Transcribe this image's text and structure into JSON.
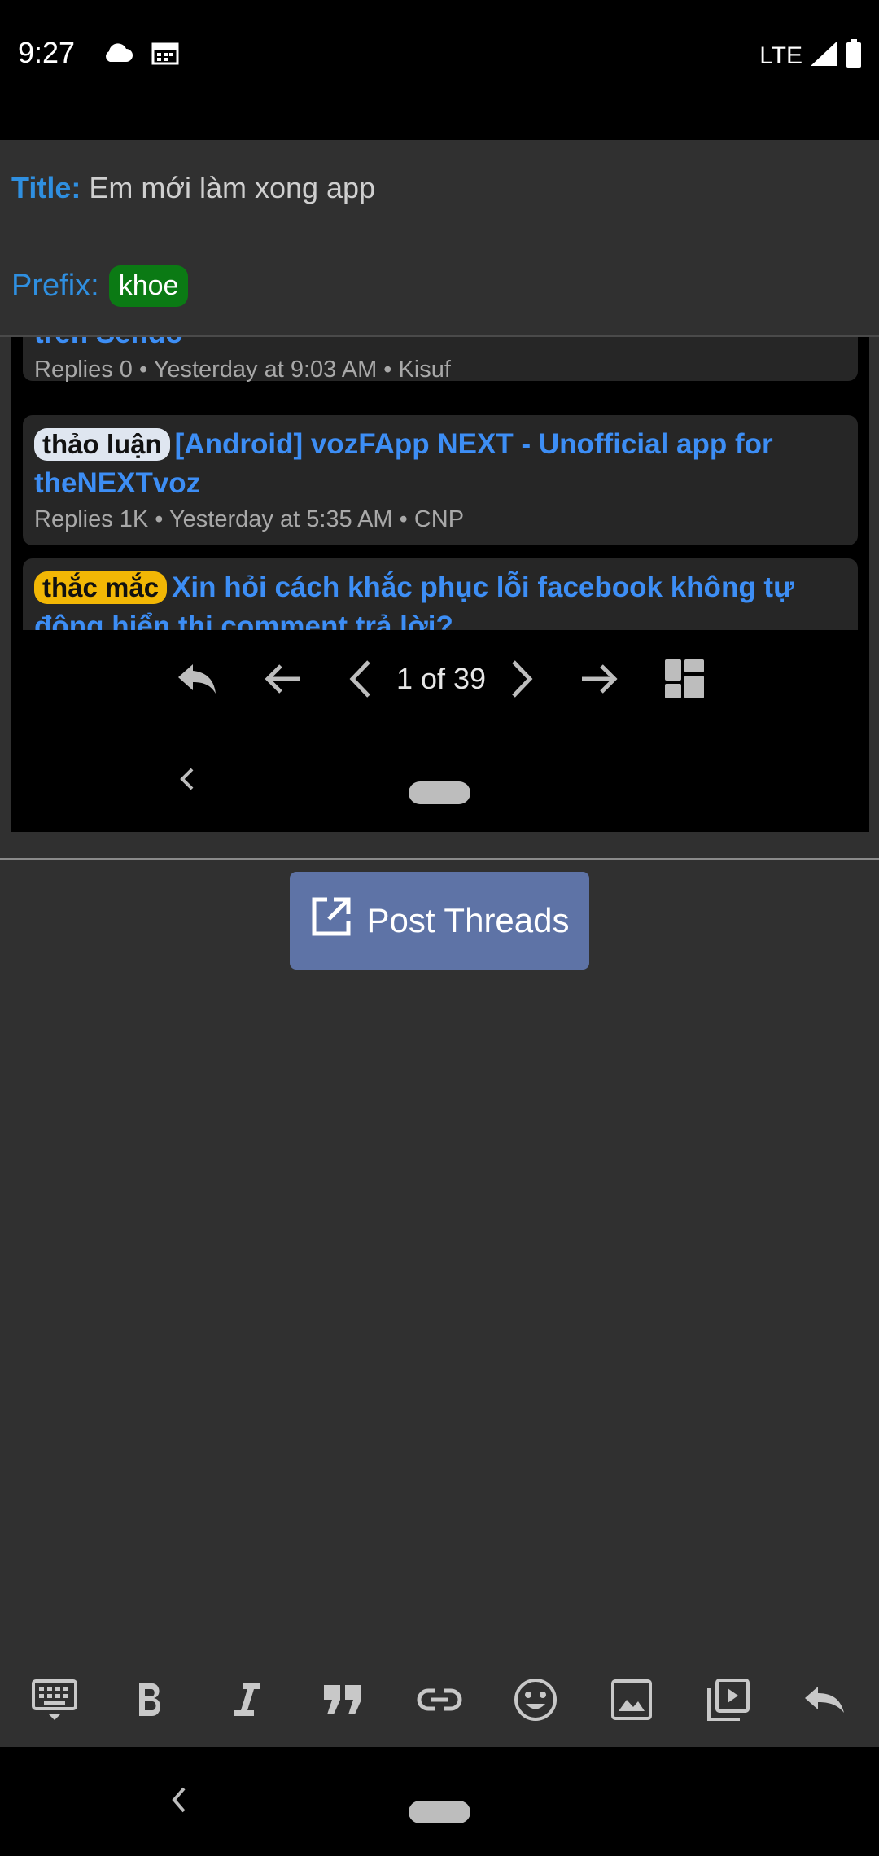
{
  "status_bar": {
    "time": "9:27",
    "network": "LTE",
    "icons": [
      "cloud-icon",
      "calendar-icon",
      "signal-icon",
      "battery-icon"
    ]
  },
  "header": {
    "title_label": "Title:",
    "title_value": "Em mới làm xong app",
    "prefix_label": "Prefix:",
    "prefix_value": "khoe",
    "prefix_color": "#0b7a14"
  },
  "preview": {
    "threads": [
      {
        "tag": "",
        "title": "trên Sendo",
        "meta": "Replies 0 • Yesterday at 9:03 AM • Kisuf"
      },
      {
        "tag": "thảo luận",
        "title": "[Android] vozFApp NEXT - Unofficial app for theNEXTvoz",
        "meta": "Replies 1K • Yesterday at 5:35 AM • CNP"
      },
      {
        "tag": "thắc mắc",
        "title": "Xin hỏi cách khắc phục lỗi facebook không tự động hiển thị comment trả lời?",
        "meta": ""
      }
    ],
    "pager": {
      "page_text": "1 of 39"
    }
  },
  "post_button": {
    "label": "Post Threads",
    "color": "#5e73a6"
  },
  "format_toolbar": {
    "buttons": [
      "keyboard-icon",
      "bold-icon",
      "italic-icon",
      "quote-icon",
      "link-icon",
      "emoji-icon",
      "image-icon",
      "video-icon",
      "undo-icon"
    ]
  },
  "colors": {
    "accent_blue": "#2f8fe0",
    "link_blue": "#3d8ef5",
    "background": "#303030"
  }
}
